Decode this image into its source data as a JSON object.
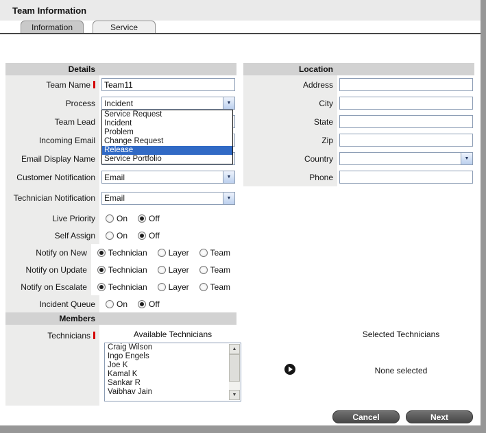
{
  "window": {
    "title": "Team Information"
  },
  "tabs": [
    {
      "label": "Information"
    },
    {
      "label": "Service"
    }
  ],
  "colors": {
    "selection_blue": "#316ac5",
    "required_red": "#d40000",
    "button_gray": "#585858"
  },
  "details": {
    "section_title": "Details",
    "rows": {
      "team_name": {
        "label": "Team Name",
        "value": "Team11"
      },
      "process": {
        "label": "Process",
        "value": "Incident"
      },
      "team_lead": {
        "label": "Team Lead",
        "value": ""
      },
      "incoming_email": {
        "label": "Incoming Email",
        "value": ""
      },
      "email_display_name": {
        "label": "Email Display Name",
        "value": ""
      },
      "customer_notification": {
        "label": "Customer Notification",
        "value": "Email"
      },
      "technician_notification": {
        "label": "Technician Notification",
        "value": "Email"
      },
      "live_priority": {
        "label": "Live Priority",
        "options": [
          "On",
          "Off"
        ],
        "selected": "Off"
      },
      "self_assign": {
        "label": "Self Assign",
        "options": [
          "On",
          "Off"
        ],
        "selected": "Off"
      },
      "notify_on_new": {
        "label": "Notify on New",
        "options": [
          "Technician",
          "Layer",
          "Team"
        ],
        "selected": "Technician"
      },
      "notify_on_update": {
        "label": "Notify on Update",
        "options": [
          "Technician",
          "Layer",
          "Team"
        ],
        "selected": "Technician"
      },
      "notify_on_escalate": {
        "label": "Notify on Escalate",
        "options": [
          "Technician",
          "Layer",
          "Team"
        ],
        "selected": "Technician"
      },
      "incident_queue": {
        "label": "Incident Queue",
        "options": [
          "On",
          "Off"
        ],
        "selected": "Off"
      }
    },
    "process_dropdown": {
      "options": [
        "Service Request",
        "Incident",
        "Problem",
        "Change Request",
        "Release",
        "Service Portfolio"
      ],
      "highlighted": "Release"
    }
  },
  "location": {
    "section_title": "Location",
    "address": {
      "label": "Address",
      "value": ""
    },
    "city": {
      "label": "City",
      "value": ""
    },
    "state": {
      "label": "State",
      "value": ""
    },
    "zip": {
      "label": "Zip",
      "value": ""
    },
    "country": {
      "label": "Country",
      "value": ""
    },
    "phone": {
      "label": "Phone",
      "value": ""
    }
  },
  "members": {
    "section_title": "Members",
    "technicians_label": "Technicians",
    "available_title": "Available Technicians",
    "selected_title": "Selected Technicians",
    "available": [
      "Craig Wilson",
      "Ingo Engels",
      "Joe K",
      "Kamal K",
      "Sankar R",
      "Vaibhav Jain"
    ],
    "selected_placeholder": "None selected"
  },
  "actions": {
    "cancel": "Cancel",
    "next": "Next"
  }
}
